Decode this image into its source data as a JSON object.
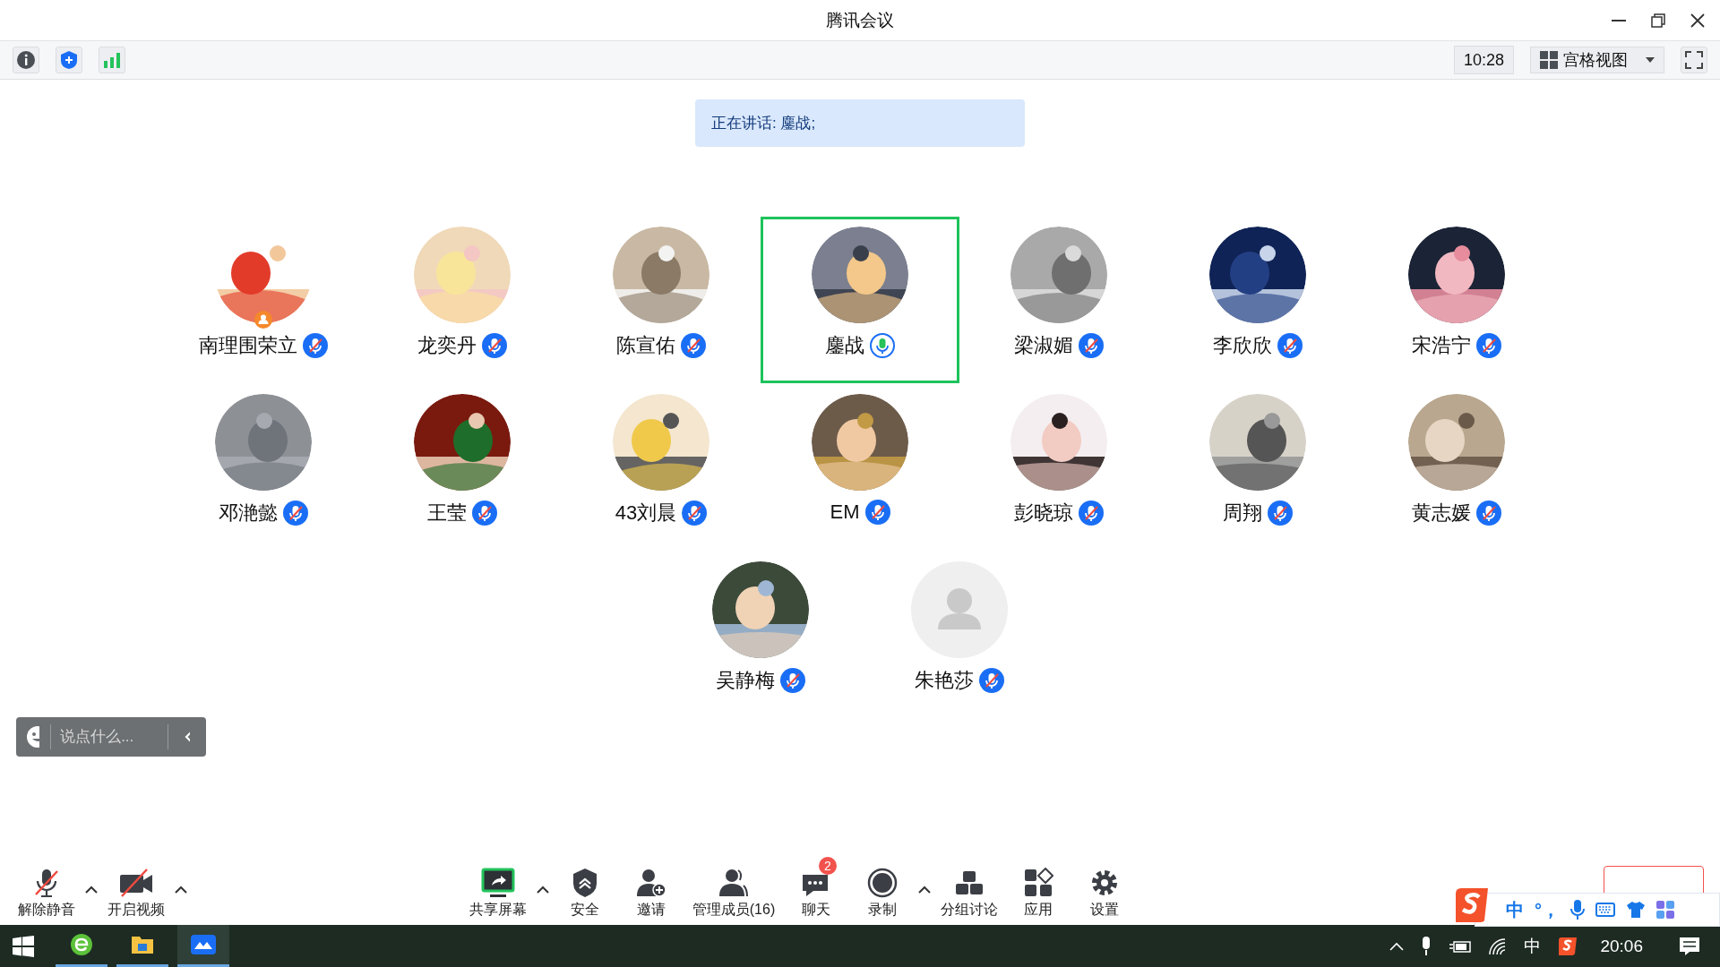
{
  "window": {
    "title": "腾讯会议"
  },
  "top_bar": {
    "time": "10:28",
    "view_mode": "宫格视图"
  },
  "speaking_banner": "正在讲话: 鏖战;",
  "participants": [
    {
      "name": "南理围荣立",
      "muted": true,
      "selected": false,
      "host": true,
      "kind": "picture"
    },
    {
      "name": "龙奕丹",
      "muted": true,
      "selected": false,
      "host": false,
      "kind": "picture"
    },
    {
      "name": "陈宣佑",
      "muted": true,
      "selected": false,
      "host": false,
      "kind": "picture"
    },
    {
      "name": "鏖战",
      "muted": false,
      "selected": true,
      "host": false,
      "kind": "picture"
    },
    {
      "name": "梁淑媚",
      "muted": true,
      "selected": false,
      "host": false,
      "kind": "picture"
    },
    {
      "name": "李欣欣",
      "muted": true,
      "selected": false,
      "host": false,
      "kind": "picture"
    },
    {
      "name": "宋浩宁",
      "muted": true,
      "selected": false,
      "host": false,
      "kind": "picture"
    },
    {
      "name": "邓滟懿",
      "muted": true,
      "selected": false,
      "host": false,
      "kind": "picture"
    },
    {
      "name": "王莹",
      "muted": true,
      "selected": false,
      "host": false,
      "kind": "picture"
    },
    {
      "name": "43刘晨",
      "muted": true,
      "selected": false,
      "host": false,
      "kind": "picture"
    },
    {
      "name": "EM",
      "muted": true,
      "selected": false,
      "host": false,
      "kind": "picture"
    },
    {
      "name": "彭晓琼",
      "muted": true,
      "selected": false,
      "host": false,
      "kind": "picture"
    },
    {
      "name": "周翔",
      "muted": true,
      "selected": false,
      "host": false,
      "kind": "picture"
    },
    {
      "name": "黄志媛",
      "muted": true,
      "selected": false,
      "host": false,
      "kind": "picture"
    },
    {
      "name": "吴静梅",
      "muted": true,
      "selected": false,
      "host": false,
      "kind": "picture"
    },
    {
      "name": "朱艳莎",
      "muted": true,
      "selected": false,
      "host": false,
      "kind": "placeholder"
    }
  ],
  "chat_input": {
    "placeholder": "说点什么..."
  },
  "toolbar_left": [
    {
      "label": "解除静音",
      "caret": true
    },
    {
      "label": "开启视频",
      "caret": true
    }
  ],
  "toolbar_center": [
    {
      "label": "共享屏幕",
      "caret": true
    },
    {
      "label": "安全",
      "caret": false
    },
    {
      "label": "邀请",
      "caret": false
    },
    {
      "label": "管理成员(16)",
      "caret": false
    },
    {
      "label": "聊天",
      "caret": false,
      "badge": "2"
    },
    {
      "label": "录制",
      "caret": true
    },
    {
      "label": "分组讨论",
      "caret": false
    },
    {
      "label": "应用",
      "caret": false
    },
    {
      "label": "设置",
      "caret": false
    }
  ],
  "ime_bar": {
    "mode": "中",
    "punct": "°，"
  },
  "taskbar": {
    "apps": [
      {
        "selected": false
      },
      {
        "selected": false
      },
      {
        "selected": true
      }
    ],
    "ime": "中",
    "clock": "20:06"
  }
}
